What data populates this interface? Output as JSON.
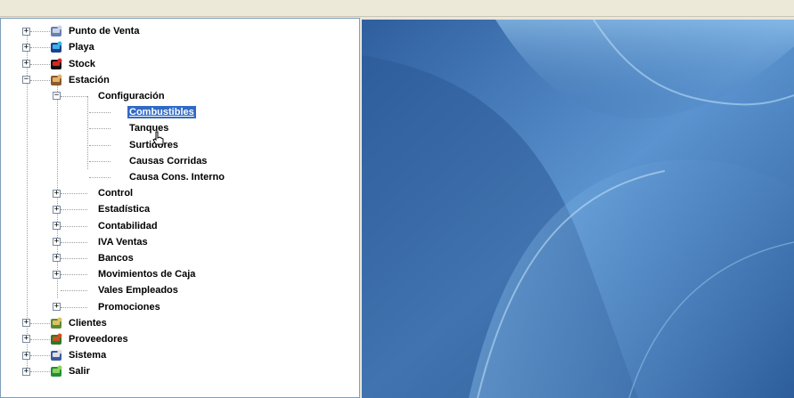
{
  "tree": {
    "root_items": [
      {
        "label": "Punto de Venta",
        "icon": "cash-register-icon",
        "expander": "+"
      },
      {
        "label": "Playa",
        "icon": "fuel-icon",
        "expander": "+"
      },
      {
        "label": "Stock",
        "icon": "stock-icon",
        "expander": "+"
      },
      {
        "label": "Estación",
        "icon": "station-icon",
        "expander": "−"
      },
      {
        "label": "Clientes",
        "icon": "clients-icon",
        "expander": "+"
      },
      {
        "label": "Proveedores",
        "icon": "suppliers-icon",
        "expander": "+"
      },
      {
        "label": "Sistema",
        "icon": "system-icon",
        "expander": "+"
      },
      {
        "label": "Salir",
        "icon": "exit-icon",
        "expander": "+"
      }
    ],
    "estacion_children": [
      {
        "label": "Configuración",
        "expander": "−"
      },
      {
        "label": "Control",
        "expander": "+"
      },
      {
        "label": "Estadística",
        "expander": "+"
      },
      {
        "label": "Contabilidad",
        "expander": "+"
      },
      {
        "label": "IVA Ventas",
        "expander": "+"
      },
      {
        "label": "Bancos",
        "expander": "+"
      },
      {
        "label": "Movimientos de Caja",
        "expander": "+"
      },
      {
        "label": "Vales Empleados",
        "expander": ""
      },
      {
        "label": "Promociones",
        "expander": "+"
      }
    ],
    "configuracion_children": [
      {
        "label": "Combustibles",
        "selected": true
      },
      {
        "label": "Tanques",
        "selected": false
      },
      {
        "label": "Surtidores",
        "selected": false
      },
      {
        "label": "Causas Corridas",
        "selected": false
      },
      {
        "label": "Causa Cons. Interno",
        "selected": false
      }
    ]
  },
  "colors": {
    "selection": "#316ac5",
    "desktop_blue": "#3f76b6"
  }
}
